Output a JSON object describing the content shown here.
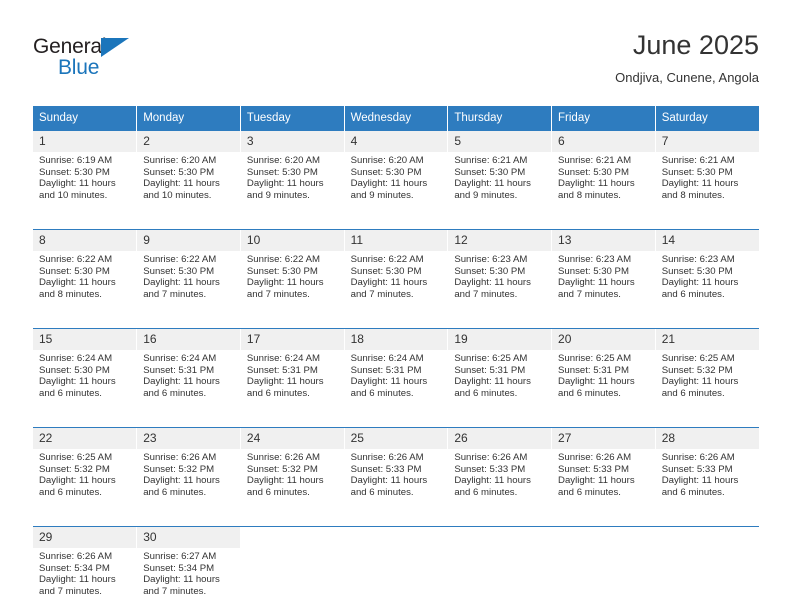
{
  "brand": {
    "name_part1": "General",
    "name_part2": "Blue",
    "accent_color": "#1b75bb"
  },
  "header": {
    "title": "June 2025",
    "subtitle": "Ondjiva, Cunene, Angola"
  },
  "theme": {
    "header_blue": "#2e7cbf",
    "daynum_background": "#f0f0f0",
    "text_color": "#333333"
  },
  "calendar": {
    "weekday_headers": [
      "Sunday",
      "Monday",
      "Tuesday",
      "Wednesday",
      "Thursday",
      "Friday",
      "Saturday"
    ],
    "weeks": [
      [
        {
          "day": "1",
          "sunrise": "Sunrise: 6:19 AM",
          "sunset": "Sunset: 5:30 PM",
          "daylight_line1": "Daylight: 11 hours",
          "daylight_line2": "and 10 minutes."
        },
        {
          "day": "2",
          "sunrise": "Sunrise: 6:20 AM",
          "sunset": "Sunset: 5:30 PM",
          "daylight_line1": "Daylight: 11 hours",
          "daylight_line2": "and 10 minutes."
        },
        {
          "day": "3",
          "sunrise": "Sunrise: 6:20 AM",
          "sunset": "Sunset: 5:30 PM",
          "daylight_line1": "Daylight: 11 hours",
          "daylight_line2": "and 9 minutes."
        },
        {
          "day": "4",
          "sunrise": "Sunrise: 6:20 AM",
          "sunset": "Sunset: 5:30 PM",
          "daylight_line1": "Daylight: 11 hours",
          "daylight_line2": "and 9 minutes."
        },
        {
          "day": "5",
          "sunrise": "Sunrise: 6:21 AM",
          "sunset": "Sunset: 5:30 PM",
          "daylight_line1": "Daylight: 11 hours",
          "daylight_line2": "and 9 minutes."
        },
        {
          "day": "6",
          "sunrise": "Sunrise: 6:21 AM",
          "sunset": "Sunset: 5:30 PM",
          "daylight_line1": "Daylight: 11 hours",
          "daylight_line2": "and 8 minutes."
        },
        {
          "day": "7",
          "sunrise": "Sunrise: 6:21 AM",
          "sunset": "Sunset: 5:30 PM",
          "daylight_line1": "Daylight: 11 hours",
          "daylight_line2": "and 8 minutes."
        }
      ],
      [
        {
          "day": "8",
          "sunrise": "Sunrise: 6:22 AM",
          "sunset": "Sunset: 5:30 PM",
          "daylight_line1": "Daylight: 11 hours",
          "daylight_line2": "and 8 minutes."
        },
        {
          "day": "9",
          "sunrise": "Sunrise: 6:22 AM",
          "sunset": "Sunset: 5:30 PM",
          "daylight_line1": "Daylight: 11 hours",
          "daylight_line2": "and 7 minutes."
        },
        {
          "day": "10",
          "sunrise": "Sunrise: 6:22 AM",
          "sunset": "Sunset: 5:30 PM",
          "daylight_line1": "Daylight: 11 hours",
          "daylight_line2": "and 7 minutes."
        },
        {
          "day": "11",
          "sunrise": "Sunrise: 6:22 AM",
          "sunset": "Sunset: 5:30 PM",
          "daylight_line1": "Daylight: 11 hours",
          "daylight_line2": "and 7 minutes."
        },
        {
          "day": "12",
          "sunrise": "Sunrise: 6:23 AM",
          "sunset": "Sunset: 5:30 PM",
          "daylight_line1": "Daylight: 11 hours",
          "daylight_line2": "and 7 minutes."
        },
        {
          "day": "13",
          "sunrise": "Sunrise: 6:23 AM",
          "sunset": "Sunset: 5:30 PM",
          "daylight_line1": "Daylight: 11 hours",
          "daylight_line2": "and 7 minutes."
        },
        {
          "day": "14",
          "sunrise": "Sunrise: 6:23 AM",
          "sunset": "Sunset: 5:30 PM",
          "daylight_line1": "Daylight: 11 hours",
          "daylight_line2": "and 6 minutes."
        }
      ],
      [
        {
          "day": "15",
          "sunrise": "Sunrise: 6:24 AM",
          "sunset": "Sunset: 5:30 PM",
          "daylight_line1": "Daylight: 11 hours",
          "daylight_line2": "and 6 minutes."
        },
        {
          "day": "16",
          "sunrise": "Sunrise: 6:24 AM",
          "sunset": "Sunset: 5:31 PM",
          "daylight_line1": "Daylight: 11 hours",
          "daylight_line2": "and 6 minutes."
        },
        {
          "day": "17",
          "sunrise": "Sunrise: 6:24 AM",
          "sunset": "Sunset: 5:31 PM",
          "daylight_line1": "Daylight: 11 hours",
          "daylight_line2": "and 6 minutes."
        },
        {
          "day": "18",
          "sunrise": "Sunrise: 6:24 AM",
          "sunset": "Sunset: 5:31 PM",
          "daylight_line1": "Daylight: 11 hours",
          "daylight_line2": "and 6 minutes."
        },
        {
          "day": "19",
          "sunrise": "Sunrise: 6:25 AM",
          "sunset": "Sunset: 5:31 PM",
          "daylight_line1": "Daylight: 11 hours",
          "daylight_line2": "and 6 minutes."
        },
        {
          "day": "20",
          "sunrise": "Sunrise: 6:25 AM",
          "sunset": "Sunset: 5:31 PM",
          "daylight_line1": "Daylight: 11 hours",
          "daylight_line2": "and 6 minutes."
        },
        {
          "day": "21",
          "sunrise": "Sunrise: 6:25 AM",
          "sunset": "Sunset: 5:32 PM",
          "daylight_line1": "Daylight: 11 hours",
          "daylight_line2": "and 6 minutes."
        }
      ],
      [
        {
          "day": "22",
          "sunrise": "Sunrise: 6:25 AM",
          "sunset": "Sunset: 5:32 PM",
          "daylight_line1": "Daylight: 11 hours",
          "daylight_line2": "and 6 minutes."
        },
        {
          "day": "23",
          "sunrise": "Sunrise: 6:26 AM",
          "sunset": "Sunset: 5:32 PM",
          "daylight_line1": "Daylight: 11 hours",
          "daylight_line2": "and 6 minutes."
        },
        {
          "day": "24",
          "sunrise": "Sunrise: 6:26 AM",
          "sunset": "Sunset: 5:32 PM",
          "daylight_line1": "Daylight: 11 hours",
          "daylight_line2": "and 6 minutes."
        },
        {
          "day": "25",
          "sunrise": "Sunrise: 6:26 AM",
          "sunset": "Sunset: 5:33 PM",
          "daylight_line1": "Daylight: 11 hours",
          "daylight_line2": "and 6 minutes."
        },
        {
          "day": "26",
          "sunrise": "Sunrise: 6:26 AM",
          "sunset": "Sunset: 5:33 PM",
          "daylight_line1": "Daylight: 11 hours",
          "daylight_line2": "and 6 minutes."
        },
        {
          "day": "27",
          "sunrise": "Sunrise: 6:26 AM",
          "sunset": "Sunset: 5:33 PM",
          "daylight_line1": "Daylight: 11 hours",
          "daylight_line2": "and 6 minutes."
        },
        {
          "day": "28",
          "sunrise": "Sunrise: 6:26 AM",
          "sunset": "Sunset: 5:33 PM",
          "daylight_line1": "Daylight: 11 hours",
          "daylight_line2": "and 6 minutes."
        }
      ],
      [
        {
          "day": "29",
          "sunrise": "Sunrise: 6:26 AM",
          "sunset": "Sunset: 5:34 PM",
          "daylight_line1": "Daylight: 11 hours",
          "daylight_line2": "and 7 minutes."
        },
        {
          "day": "30",
          "sunrise": "Sunrise: 6:27 AM",
          "sunset": "Sunset: 5:34 PM",
          "daylight_line1": "Daylight: 11 hours",
          "daylight_line2": "and 7 minutes."
        },
        {
          "day": "",
          "sunrise": "",
          "sunset": "",
          "daylight_line1": "",
          "daylight_line2": ""
        },
        {
          "day": "",
          "sunrise": "",
          "sunset": "",
          "daylight_line1": "",
          "daylight_line2": ""
        },
        {
          "day": "",
          "sunrise": "",
          "sunset": "",
          "daylight_line1": "",
          "daylight_line2": ""
        },
        {
          "day": "",
          "sunrise": "",
          "sunset": "",
          "daylight_line1": "",
          "daylight_line2": ""
        },
        {
          "day": "",
          "sunrise": "",
          "sunset": "",
          "daylight_line1": "",
          "daylight_line2": ""
        }
      ]
    ]
  }
}
